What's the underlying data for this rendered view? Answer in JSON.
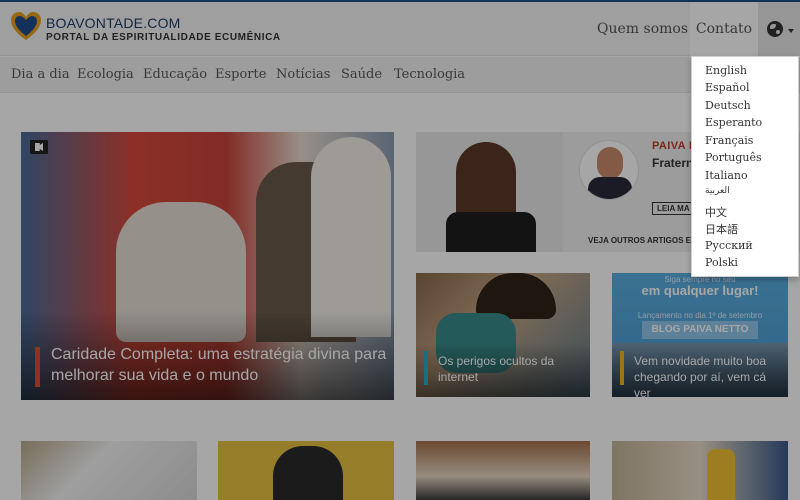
{
  "header": {
    "logo_name": "BOAVONTADE.COM",
    "logo_sub": "PORTAL DA ESPIRITUALIDADE ECUMÊNICA",
    "nav": [
      "Quem somos",
      "Contato"
    ]
  },
  "categories": [
    "Dia a dia",
    "Ecologia",
    "Educação",
    "Esporte",
    "Notícias",
    "Saúde",
    "Tecnologia"
  ],
  "hero": {
    "title": "Caridade Completa: uma estratégia divina para melhorar sua vida e o mundo"
  },
  "promo": {
    "label": "PAIVA N",
    "teaser": "Fratern realiza humano",
    "button": "LEIA MA",
    "more": "VEJA OUTROS ARTIGOS EM"
  },
  "cards": [
    {
      "title": "Os perigos ocultos da internet",
      "accent": "#2aa8c8"
    },
    {
      "title": "Vem novidade muito boa chegando por aí, vem cá ver",
      "accent": "#e8b820"
    }
  ],
  "blog_banner": {
    "line1": "Siga sempre no seu",
    "headline": "em qualquer lugar!",
    "line3": "Lançamento no dia 1º de setembro",
    "button": "BLOG PAIVA NETTO"
  },
  "languages": [
    "English",
    "Español",
    "Deutsch",
    "Esperanto",
    "Français",
    "Português",
    "Italiano",
    "العربية",
    "中文",
    "日本語",
    "Русский",
    "Polski"
  ],
  "colors": {
    "brand": "#1e4c8a",
    "hero_accent": "#e04a2a",
    "promo_label": "#c03a2a"
  }
}
